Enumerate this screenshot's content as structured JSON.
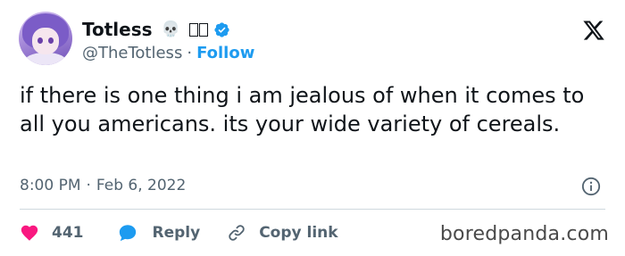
{
  "tweet": {
    "display_name": "Totless",
    "name_emoji": "💀",
    "handle": "@TheTotless",
    "separator": "·",
    "follow_label": "Follow",
    "text": "if there is one thing i am jealous of when it comes to all you americans. its your wide variety of cereals.",
    "time": "8:00 PM",
    "date": "Feb 6, 2022",
    "likes": "441",
    "reply_label": "Reply",
    "copy_link_label": "Copy link"
  },
  "watermark": "boredpanda.com",
  "colors": {
    "accent": "#1d9bf0",
    "like": "#f91880",
    "text": "#0f1419",
    "muted": "#536471"
  },
  "icons": [
    "avatar",
    "skull-emoji",
    "verified-badge-icon",
    "x-logo-icon",
    "info-icon",
    "heart-icon",
    "reply-bubble-icon",
    "link-icon"
  ]
}
